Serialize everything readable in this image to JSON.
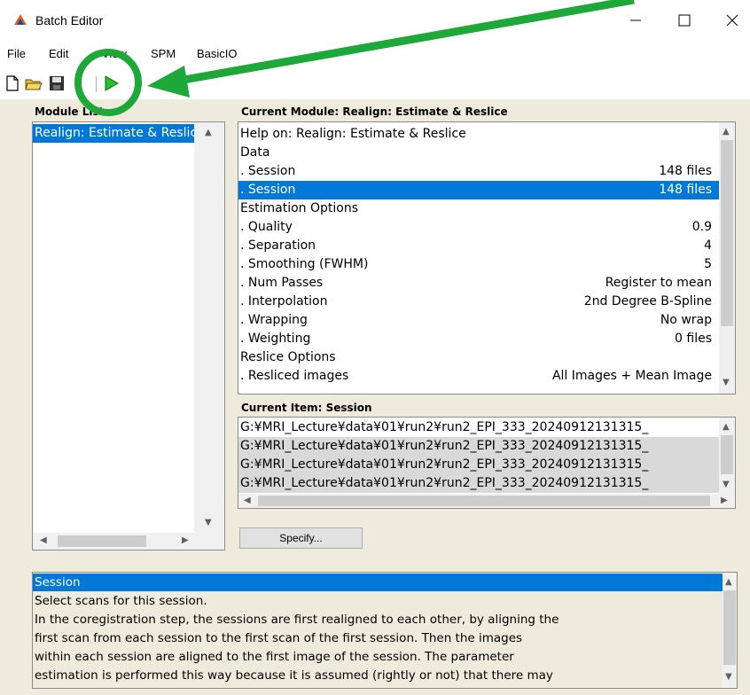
{
  "window": {
    "title": "Batch Editor"
  },
  "menu": {
    "items": [
      "File",
      "Edit",
      "View",
      "SPM",
      "BasicIO"
    ]
  },
  "module_list": {
    "label": "Module List",
    "items": [
      "Realign: Estimate & Reslice"
    ]
  },
  "current_module": {
    "label": "Current Module: Realign: Estimate & Reslice",
    "rows": [
      {
        "name": "Help on: Realign: Estimate & Reslice",
        "value": ""
      },
      {
        "name": "Data",
        "value": ""
      },
      {
        "name": ". Session",
        "value": "148 files"
      },
      {
        "name": ". Session",
        "value": "148 files"
      },
      {
        "name": "Estimation Options",
        "value": ""
      },
      {
        "name": ". Quality",
        "value": "0.9"
      },
      {
        "name": ". Separation",
        "value": "4"
      },
      {
        "name": ". Smoothing (FWHM)",
        "value": "5"
      },
      {
        "name": ". Num Passes",
        "value": "Register to mean"
      },
      {
        "name": ". Interpolation",
        "value": "2nd Degree B-Spline"
      },
      {
        "name": ". Wrapping",
        "value": "No wrap"
      },
      {
        "name": ". Weighting",
        "value": "0 files"
      },
      {
        "name": "Reslice Options",
        "value": ""
      },
      {
        "name": ". Resliced images",
        "value": "All Images + Mean Image"
      }
    ]
  },
  "current_item": {
    "label": "Current Item: Session",
    "rows": [
      "G:¥MRI_Lecture¥data¥01¥run2¥run2_EPI_333_20240912131315_",
      "G:¥MRI_Lecture¥data¥01¥run2¥run2_EPI_333_20240912131315_",
      "G:¥MRI_Lecture¥data¥01¥run2¥run2_EPI_333_20240912131315_",
      "G:¥MRI_Lecture¥data¥01¥run2¥run2_EPI_333_20240912131315_"
    ]
  },
  "specify_button": {
    "label": "Specify..."
  },
  "help": {
    "title": "Session",
    "lines": [
      "Select scans for this session.",
      "In  the coregistration step, the sessions are first realigned to each other, by aligning the",
      "first  scan  from  each  session  to  the  first scan of the first session.  Then the images",
      "within  each  session  are  aligned  to  the  first  image  of  the  session. The parameter",
      "estimation  is  performed  this way because it is assumed (rightly or not) that there may"
    ]
  },
  "colors": {
    "selection": "#0078d7",
    "panel_bg": "#efebdc",
    "annotation_green": "#1fa83a"
  }
}
